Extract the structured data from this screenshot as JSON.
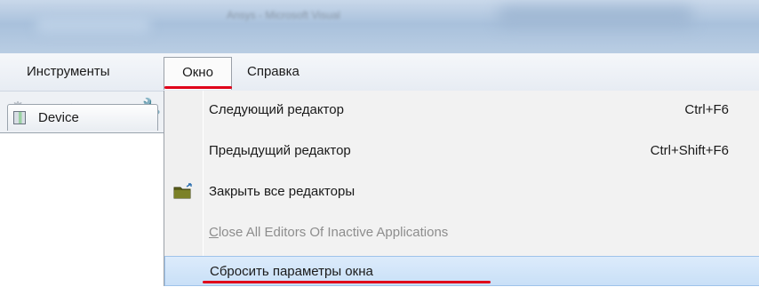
{
  "window": {
    "title": "Ansys - Microsoft Visual"
  },
  "menubar": {
    "items": [
      {
        "label": "Инструменты"
      },
      {
        "label": "Окно"
      },
      {
        "label": "Справка"
      }
    ]
  },
  "tab": {
    "label": "Device"
  },
  "window_menu": {
    "items": [
      {
        "label": "Следующий редактор",
        "shortcut": "Ctrl+F6",
        "enabled": true,
        "icon": ""
      },
      {
        "label": "Предыдущий редактор",
        "shortcut": "Ctrl+Shift+F6",
        "enabled": true,
        "icon": ""
      },
      {
        "label": "Закрыть все редакторы",
        "shortcut": "",
        "enabled": true,
        "icon": "close-all-folder-icon"
      },
      {
        "label": "Close All Editors Of Inactive Applications",
        "shortcut": "",
        "enabled": false,
        "icon": ""
      },
      {
        "label": "Сбросить параметры окна",
        "shortcut": "",
        "enabled": true,
        "icon": "",
        "highlighted": true
      }
    ]
  },
  "colors": {
    "annotation_red": "#e0001a",
    "highlight": "#cce4f7",
    "disabled_text": "#8d8d8d"
  }
}
